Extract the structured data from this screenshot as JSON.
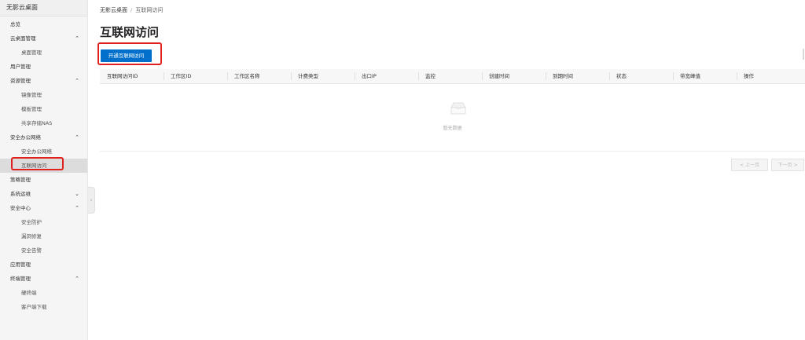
{
  "sidebar": {
    "title": "无影云桌面",
    "items": [
      {
        "label": "总览",
        "type": "group"
      },
      {
        "label": "云桌面管理",
        "type": "group",
        "chevron": "up"
      },
      {
        "label": "桌面管理",
        "type": "sub"
      },
      {
        "label": "用户管理",
        "type": "group"
      },
      {
        "label": "资源管理",
        "type": "group",
        "chevron": "up"
      },
      {
        "label": "镜像管理",
        "type": "sub"
      },
      {
        "label": "模板管理",
        "type": "sub"
      },
      {
        "label": "共享存储NAS",
        "type": "sub"
      },
      {
        "label": "安全办公网络",
        "type": "group",
        "chevron": "up"
      },
      {
        "label": "安全办公网络",
        "type": "sub"
      },
      {
        "label": "互联网访问",
        "type": "sub",
        "active": true
      },
      {
        "label": "策略管理",
        "type": "group"
      },
      {
        "label": "系统运维",
        "type": "group",
        "chevron": "down"
      },
      {
        "label": "安全中心",
        "type": "group",
        "chevron": "up"
      },
      {
        "label": "安全防护",
        "type": "sub"
      },
      {
        "label": "漏洞修复",
        "type": "sub"
      },
      {
        "label": "安全告警",
        "type": "sub"
      },
      {
        "label": "应用管理",
        "type": "group"
      },
      {
        "label": "终端管理",
        "type": "group",
        "chevron": "up"
      },
      {
        "label": "硬终端",
        "type": "sub"
      },
      {
        "label": "客户端下载",
        "type": "sub"
      }
    ]
  },
  "breadcrumb": {
    "root": "无影云桌面",
    "separator": "/",
    "current": "互联网访问"
  },
  "page": {
    "title": "互联网访问",
    "primary_button": "开通互联网访问"
  },
  "table": {
    "columns": [
      "互联网访问ID",
      "工作区ID",
      "工作区名称",
      "计费类型",
      "出口IP",
      "监控",
      "创建时间",
      "到期时间",
      "状态",
      "带宽峰值",
      "操作"
    ],
    "empty_text": "暂无数据"
  },
  "pagination": {
    "prev": "< 上一页",
    "next": "下一页 >"
  },
  "colors": {
    "primary": "#0070cc",
    "highlight": "#e0211d"
  }
}
